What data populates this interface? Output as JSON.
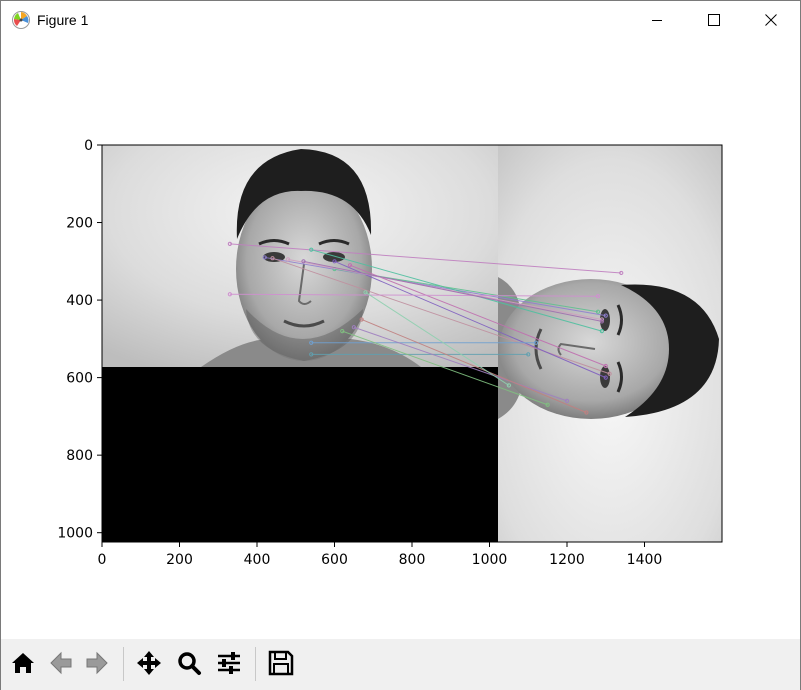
{
  "window": {
    "title": "Figure 1",
    "icon": "matplotlib-icon",
    "controls": [
      "minimize-icon",
      "maximize-icon",
      "close-icon"
    ]
  },
  "toolbar": {
    "buttons": [
      {
        "name": "home-button",
        "icon": "home-icon"
      },
      {
        "name": "back-button",
        "icon": "arrow-left-icon"
      },
      {
        "name": "forward-button",
        "icon": "arrow-right-icon"
      },
      {
        "name": "pan-button",
        "icon": "move-icon"
      },
      {
        "name": "zoom-button",
        "icon": "magnifier-icon"
      },
      {
        "name": "configure-subplots-button",
        "icon": "sliders-icon"
      },
      {
        "name": "save-button",
        "icon": "floppy-disk-icon"
      }
    ]
  },
  "plot": {
    "image_description": "feature matches between a face photo and a rotated copy",
    "x_ticks": [
      "0",
      "200",
      "400",
      "600",
      "800",
      "1000",
      "1200",
      "1400"
    ],
    "y_ticks": [
      "0",
      "200",
      "400",
      "600",
      "800",
      "1000"
    ],
    "x_tick_values": [
      0,
      200,
      400,
      600,
      800,
      1000,
      1200,
      1400
    ],
    "y_tick_values": [
      0,
      200,
      400,
      600,
      800,
      1000
    ],
    "xlim": [
      0,
      1600
    ],
    "ylim": [
      1024,
      0
    ],
    "left_image_extent": {
      "width": 1024,
      "height": 576
    },
    "right_image_extent": {
      "x_start": 1024,
      "x_end": 1600,
      "height": 1024
    },
    "match_lines": [
      {
        "x1": 330,
        "y1": 255,
        "x2": 1340,
        "y2": 330,
        "color": "#c080c0"
      },
      {
        "x1": 420,
        "y1": 290,
        "x2": 1300,
        "y2": 440,
        "color": "#9080d0"
      },
      {
        "x1": 440,
        "y1": 292,
        "x2": 1310,
        "y2": 590,
        "color": "#c090a0"
      },
      {
        "x1": 540,
        "y1": 270,
        "x2": 1290,
        "y2": 480,
        "color": "#50c0a0"
      },
      {
        "x1": 600,
        "y1": 300,
        "x2": 1300,
        "y2": 600,
        "color": "#8060c0"
      },
      {
        "x1": 600,
        "y1": 320,
        "x2": 1280,
        "y2": 430,
        "color": "#60c090"
      },
      {
        "x1": 640,
        "y1": 310,
        "x2": 1300,
        "y2": 570,
        "color": "#c070b0"
      },
      {
        "x1": 540,
        "y1": 510,
        "x2": 1120,
        "y2": 510,
        "color": "#70a0d0"
      },
      {
        "x1": 540,
        "y1": 540,
        "x2": 1100,
        "y2": 540,
        "color": "#60a0b0"
      },
      {
        "x1": 620,
        "y1": 480,
        "x2": 1150,
        "y2": 670,
        "color": "#80c080"
      },
      {
        "x1": 650,
        "y1": 470,
        "x2": 1200,
        "y2": 660,
        "color": "#a080c0"
      },
      {
        "x1": 670,
        "y1": 450,
        "x2": 1250,
        "y2": 690,
        "color": "#c08080"
      },
      {
        "x1": 330,
        "y1": 385,
        "x2": 1280,
        "y2": 390,
        "color": "#d090d0"
      },
      {
        "x1": 680,
        "y1": 380,
        "x2": 1050,
        "y2": 620,
        "color": "#90d0b0"
      },
      {
        "x1": 480,
        "y1": 295,
        "x2": 1290,
        "y2": 450,
        "color": "#d0a0c0"
      },
      {
        "x1": 520,
        "y1": 300,
        "x2": 1290,
        "y2": 455,
        "color": "#a070b0"
      }
    ]
  }
}
